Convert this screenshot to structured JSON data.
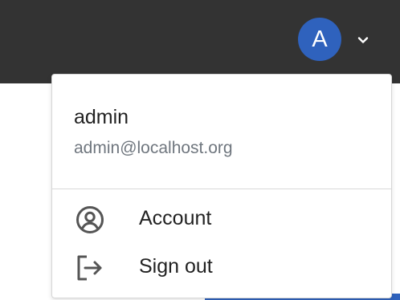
{
  "header": {
    "avatar_letter": "A",
    "avatar_color": "#2f62bd",
    "background_color": "#333333",
    "dropdown_icon": "chevron-down-icon"
  },
  "user_menu": {
    "username": "admin",
    "email": "admin@localhost.org",
    "items": [
      {
        "label": "Account",
        "icon": "account-circle-icon"
      },
      {
        "label": "Sign out",
        "icon": "sign-out-icon"
      }
    ]
  }
}
